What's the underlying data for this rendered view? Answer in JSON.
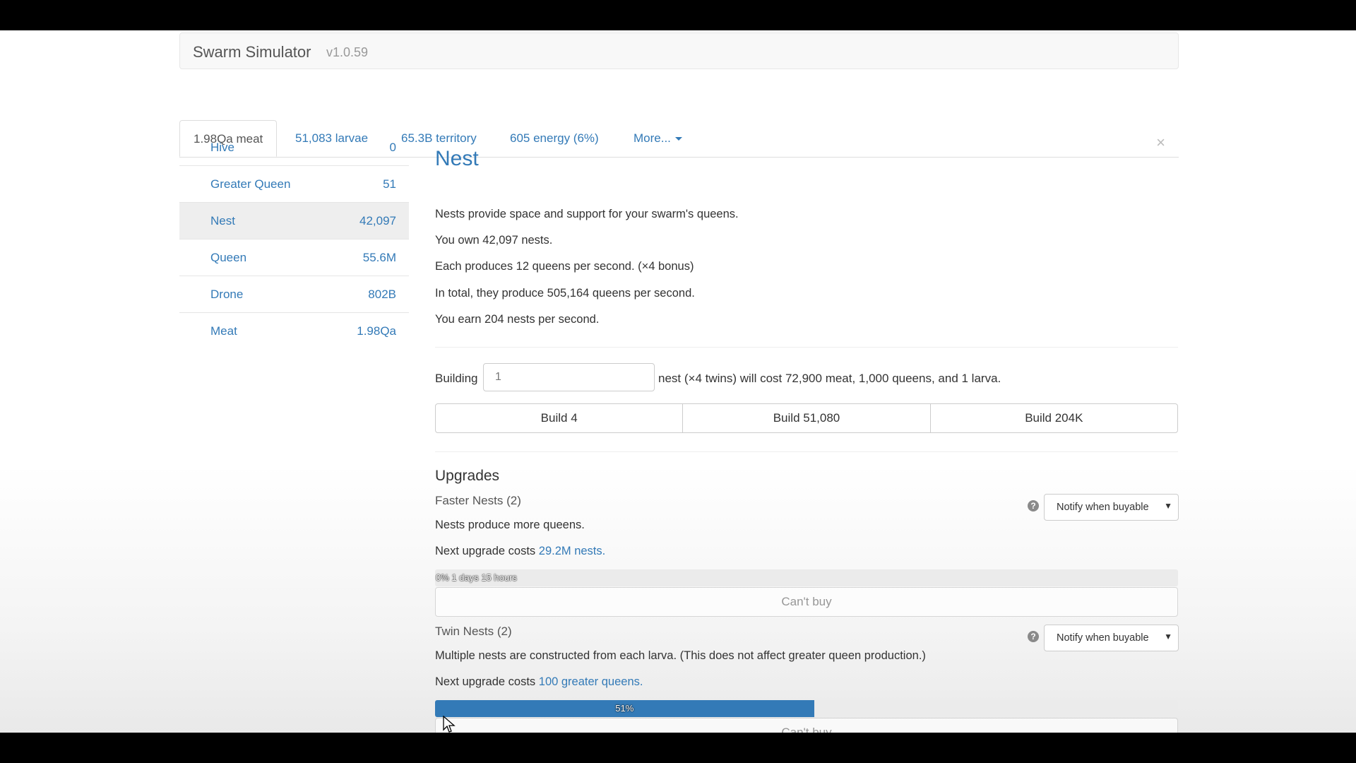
{
  "app": {
    "title": "Swarm Simulator",
    "version": "v1.0.59"
  },
  "tabs": [
    {
      "label": "1.98Qa meat"
    },
    {
      "label": "51,083 larvae"
    },
    {
      "label": "65.3B territory"
    },
    {
      "label": "605 energy (6%)"
    },
    {
      "label": "More..."
    }
  ],
  "sidebar": {
    "items": [
      {
        "name": "Hive",
        "count": "0"
      },
      {
        "name": "Greater Queen",
        "count": "51"
      },
      {
        "name": "Nest",
        "count": "42,097"
      },
      {
        "name": "Queen",
        "count": "55.6M"
      },
      {
        "name": "Drone",
        "count": "802B"
      },
      {
        "name": "Meat",
        "count": "1.98Qa"
      }
    ]
  },
  "detail": {
    "close": "×",
    "title": "Nest",
    "description": "Nests provide space and support for your swarm's queens.",
    "own": "You own 42,097 nests.",
    "each": "Each produces 12 queens per second. (×4 bonus)",
    "total": "In total, they produce 505,164 queens per second.",
    "earn": "You earn 204 nests per second.",
    "build": {
      "label": "Building",
      "input_value": "1",
      "cost_text": "nest (×4 twins) will cost 72,900 meat, 1,000 queens, and 1 larva.",
      "buttons": [
        "Build 4",
        "Build 51,080",
        "Build 204K"
      ]
    },
    "upgrades_heading": "Upgrades",
    "upgrades": [
      {
        "name": "Faster Nests (2)",
        "description": "Nests produce more queens.",
        "cost_prefix": "Next upgrade costs",
        "cost_link": "29.2M nests.",
        "progress_percent": 0,
        "progress_label": "0% 1 days 15 hours",
        "notify": "Notify when buyable",
        "button": "Can't buy"
      },
      {
        "name": "Twin Nests (2)",
        "description": "Multiple nests are constructed from each larva. (This does not affect greater queen production.)",
        "cost_prefix": "Next upgrade costs",
        "cost_link": "100 greater queens.",
        "progress_percent": 51,
        "progress_label": "51%",
        "notify": "Notify when buyable",
        "button": "Can't buy"
      }
    ],
    "help_glyph": "?"
  }
}
